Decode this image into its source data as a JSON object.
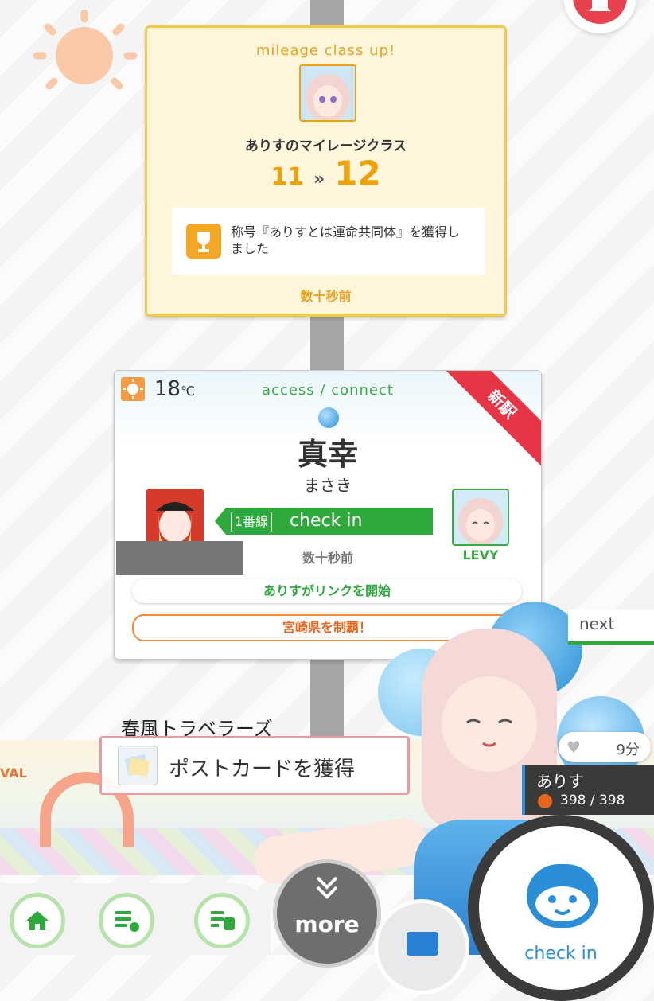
{
  "mileage_card": {
    "header": "mileage class up!",
    "subtitle": "ありすのマイレージクラス",
    "class_from": "11",
    "arrow": "»",
    "class_to": "12",
    "title_message": "称号『ありすとは運命共同体』を獲得しました",
    "time": "数十秒前"
  },
  "checkin_card": {
    "temperature": "18",
    "temperature_unit": "℃",
    "header": "access / connect",
    "badge": "新駅",
    "station_name": "真幸",
    "station_kana": "まさき",
    "line_tag": "1番線",
    "action": "check in",
    "partner_name": "LEVY",
    "time": "数十秒前",
    "link_message": "ありすがリンクを開始",
    "conquer_message": "宮崎県を制覇！"
  },
  "brand_logo": "春風トラベラーズ",
  "festival_sign": "IVAL",
  "postcard_toast": "ポストカードを獲得",
  "next_label": "next",
  "character": {
    "name": "ありす",
    "hp": "398 / 398",
    "time_left": "9分"
  },
  "navigation": {
    "more_label": "more",
    "checkin_label": "check in"
  }
}
